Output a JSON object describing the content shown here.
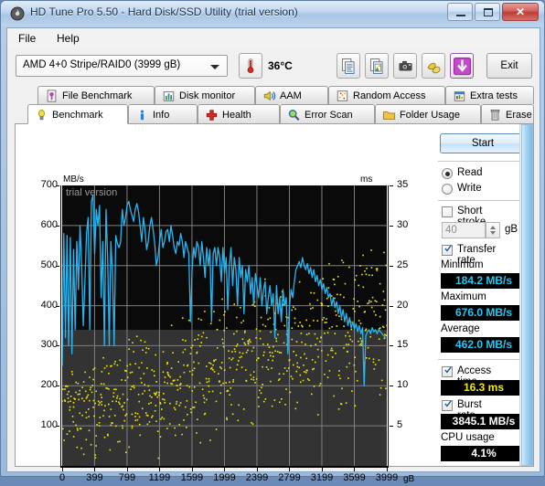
{
  "window": {
    "title": "HD Tune Pro 5.50 - Hard Disk/SSD Utility (trial version)",
    "icon": "hdd-icon",
    "minimize_label": "–",
    "maximize_label": "□",
    "close_label": "✕"
  },
  "menu": {
    "items": [
      {
        "label": "File",
        "accel": "F"
      },
      {
        "label": "Help",
        "accel": "H"
      }
    ]
  },
  "toolbar": {
    "drive": {
      "value": "AMD    4+0 Stripe/RAID0 (3999 gB)",
      "icon": "chevron-down-icon"
    },
    "temperature": {
      "icon": "thermometer-icon",
      "value": "36°C"
    },
    "buttons": [
      {
        "name": "copy-text-button",
        "icon": "copy-document-icon"
      },
      {
        "name": "copy-image-button",
        "icon": "copy-image-icon"
      },
      {
        "name": "screenshot-button",
        "icon": "camera-icon"
      },
      {
        "name": "folder-compare-button",
        "icon": "hands-icon"
      },
      {
        "name": "download-button",
        "icon": "download-arrow-icon"
      }
    ],
    "exit_label": "Exit"
  },
  "tabs": {
    "row1": [
      {
        "label": "File Benchmark",
        "icon": "file-benchmark-icon",
        "active": false
      },
      {
        "label": "Disk monitor",
        "icon": "bar-chart-icon",
        "active": false
      },
      {
        "label": "AAM",
        "icon": "speaker-icon",
        "active": false
      },
      {
        "label": "Random Access",
        "icon": "scatter-icon",
        "active": false
      },
      {
        "label": "Extra tests",
        "icon": "extra-tests-icon",
        "active": false
      }
    ],
    "row2": [
      {
        "label": "Benchmark",
        "icon": "lightbulb-icon",
        "active": true
      },
      {
        "label": "Info",
        "icon": "info-icon",
        "active": false
      },
      {
        "label": "Health",
        "icon": "red-cross-icon",
        "active": false
      },
      {
        "label": "Error Scan",
        "icon": "magnifier-icon",
        "active": false
      },
      {
        "label": "Folder Usage",
        "icon": "folder-icon",
        "active": false
      },
      {
        "label": "Erase",
        "icon": "trash-icon",
        "active": false
      }
    ]
  },
  "results": {
    "start_label": "Start",
    "mode": [
      {
        "label": "Read",
        "selected": true
      },
      {
        "label": "Write",
        "selected": false
      }
    ],
    "short_stroke": {
      "label": "Short stroke",
      "checked": false,
      "value": "40",
      "unit": "gB"
    },
    "transfer_rate": {
      "label": "Transfer rate",
      "checked": true,
      "minimum_label": "Minimum",
      "minimum_value": "184.2 MB/s",
      "maximum_label": "Maximum",
      "maximum_value": "676.0 MB/s",
      "average_label": "Average",
      "average_value": "462.0 MB/s"
    },
    "access_time": {
      "label": "Access time",
      "checked": true,
      "value": "16.3 ms"
    },
    "burst_rate": {
      "label": "Burst rate",
      "checked": true,
      "value": "3845.1 MB/s"
    },
    "cpu_usage": {
      "label": "CPU usage",
      "value": "4.1%"
    }
  },
  "colors": {
    "transfer_curve": "#29b6f0",
    "access_points": "#f2e80a",
    "value_cyan": "#24c8f0",
    "value_yellow": "#f2e80a",
    "value_white": "#ffffff",
    "plot_bg_top": "#0a0a0a",
    "plot_bg_bottom": "#333333",
    "grid": "#808080"
  },
  "chart_data": {
    "type": "line",
    "title": "",
    "watermark": "trial version",
    "ylabel_left": "MB/s",
    "ylabel_right": "ms",
    "xlabel": "gB",
    "xlim": [
      0,
      3999
    ],
    "ylim_left": [
      0,
      700
    ],
    "ylim_right": [
      0,
      35
    ],
    "grid": true,
    "yticks_left": [
      100,
      200,
      300,
      400,
      500,
      600,
      700
    ],
    "yticks_right": [
      5,
      10,
      15,
      20,
      25,
      30,
      35
    ],
    "xticks": [
      0,
      399,
      799,
      1199,
      1599,
      1999,
      2399,
      2799,
      3199,
      3599,
      3999
    ],
    "xtick_labels": [
      "0",
      "399",
      "799",
      "1199",
      "1599",
      "1999",
      "2399",
      "2799",
      "3199",
      "3599",
      "3999"
    ],
    "series": [
      {
        "name": "Transfer rate",
        "axis": "left",
        "color": "#29b6f0",
        "unit": "MB/s",
        "x": [
          0,
          20,
          40,
          60,
          80,
          100,
          120,
          140,
          160,
          180,
          200,
          220,
          240,
          260,
          280,
          300,
          320,
          340,
          360,
          380,
          400,
          420,
          440,
          460,
          480,
          500,
          520,
          540,
          560,
          580,
          600,
          620,
          640,
          660,
          680,
          700,
          720,
          740,
          760,
          780,
          800,
          820,
          840,
          860,
          880,
          900,
          920,
          940,
          960,
          980,
          1000,
          1020,
          1040,
          1060,
          1080,
          1100,
          1120,
          1140,
          1160,
          1180,
          1200,
          1220,
          1240,
          1260,
          1280,
          1300,
          1320,
          1340,
          1360,
          1380,
          1400,
          1420,
          1440,
          1460,
          1480,
          1500,
          1520,
          1540,
          1560,
          1580,
          1600,
          1620,
          1640,
          1660,
          1680,
          1700,
          1720,
          1740,
          1760,
          1780,
          1800,
          1820,
          1840,
          1860,
          1880,
          1900,
          1920,
          1940,
          1960,
          1980,
          2000,
          2020,
          2040,
          2060,
          2080,
          2100,
          2120,
          2140,
          2160,
          2180,
          2200,
          2220,
          2240,
          2260,
          2280,
          2300,
          2320,
          2340,
          2360,
          2380,
          2400,
          2420,
          2440,
          2460,
          2480,
          2500,
          2520,
          2540,
          2560,
          2580,
          2600,
          2620,
          2640,
          2660,
          2680,
          2700,
          2720,
          2740,
          2760,
          2780,
          2800,
          2820,
          2840,
          2860,
          2880,
          2900,
          2920,
          2940,
          2960,
          2980,
          3000,
          3020,
          3040,
          3060,
          3080,
          3100,
          3120,
          3140,
          3160,
          3180,
          3200,
          3220,
          3240,
          3260,
          3280,
          3300,
          3320,
          3340,
          3360,
          3380,
          3400,
          3420,
          3440,
          3460,
          3480,
          3500,
          3520,
          3540,
          3560,
          3580,
          3600,
          3620,
          3640,
          3660,
          3680,
          3700,
          3720,
          3740,
          3760,
          3780,
          3800,
          3820,
          3840,
          3860,
          3880,
          3900,
          3920,
          3940,
          3960,
          3980,
          3999
        ],
        "values": [
          250,
          580,
          320,
          575,
          300,
          570,
          280,
          540,
          340,
          560,
          440,
          600,
          500,
          350,
          460,
          580,
          620,
          340,
          660,
          676,
          530,
          640,
          600,
          650,
          420,
          560,
          300,
          640,
          520,
          300,
          560,
          480,
          300,
          575,
          555,
          545,
          560,
          640,
          600,
          620,
          650,
          660,
          640,
          625,
          610,
          640,
          655,
          635,
          600,
          560,
          620,
          590,
          540,
          560,
          600,
          620,
          590,
          555,
          500,
          520,
          560,
          590,
          545,
          560,
          585,
          590,
          560,
          600,
          575,
          545,
          530,
          560,
          550,
          580,
          560,
          520,
          560,
          545,
          530,
          360,
          490,
          545,
          520,
          560,
          545,
          500,
          560,
          520,
          470,
          545,
          500,
          540,
          360,
          530,
          545,
          500,
          545,
          520,
          460,
          545,
          480,
          520,
          390,
          500,
          545,
          450,
          520,
          490,
          400,
          520,
          470,
          500,
          380,
          490,
          460,
          500,
          430,
          470,
          400,
          480,
          450,
          420,
          470,
          400,
          440,
          460,
          380,
          420,
          450,
          400,
          430,
          320,
          450,
          380,
          420,
          360,
          440,
          400,
          420,
          280,
          400,
          440,
          420,
          460,
          490,
          500,
          510,
          495,
          520,
          500,
          490,
          505,
          480,
          495,
          470,
          490,
          460,
          475,
          450,
          465,
          440,
          455,
          430,
          445,
          420,
          430,
          400,
          420,
          395,
          410,
          380,
          400,
          370,
          390,
          360,
          380,
          350,
          370,
          345,
          360,
          340,
          355,
          335,
          350,
          330,
          345,
          200,
          325,
          335,
          340,
          330,
          345,
          335,
          340,
          330,
          340,
          335,
          330,
          325,
          320
        ]
      },
      {
        "name": "Access time",
        "axis": "right",
        "color": "#f2e80a",
        "unit": "ms",
        "description": "Yellow scatter points, access time samples spread from ~1 ms to ~29 ms across the full capacity range, with density increasing toward higher LBA."
      }
    ]
  }
}
